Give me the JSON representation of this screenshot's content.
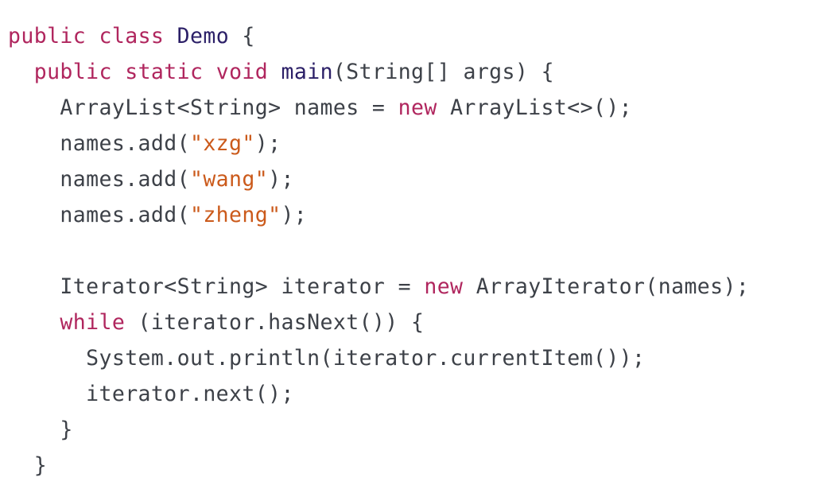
{
  "colors": {
    "default": "#3d4148",
    "keyword": "#b0265e",
    "class_name": "#2b1f67",
    "method_name": "#2b1f67",
    "string": "#cb5a1b"
  },
  "code": {
    "lines": [
      {
        "indent": 0,
        "tokens": [
          {
            "text": "public",
            "kind": "keyword"
          },
          {
            "text": " ",
            "kind": "default"
          },
          {
            "text": "class",
            "kind": "keyword"
          },
          {
            "text": " ",
            "kind": "default"
          },
          {
            "text": "Demo",
            "kind": "class_name"
          },
          {
            "text": " {",
            "kind": "default"
          }
        ]
      },
      {
        "indent": 1,
        "tokens": [
          {
            "text": "public",
            "kind": "keyword"
          },
          {
            "text": " ",
            "kind": "default"
          },
          {
            "text": "static",
            "kind": "keyword"
          },
          {
            "text": " ",
            "kind": "default"
          },
          {
            "text": "void",
            "kind": "keyword"
          },
          {
            "text": " ",
            "kind": "default"
          },
          {
            "text": "main",
            "kind": "method_name"
          },
          {
            "text": "(String[] args) {",
            "kind": "default"
          }
        ]
      },
      {
        "indent": 2,
        "tokens": [
          {
            "text": "ArrayList<String> names = ",
            "kind": "default"
          },
          {
            "text": "new",
            "kind": "keyword"
          },
          {
            "text": " ArrayList<>();",
            "kind": "default"
          }
        ]
      },
      {
        "indent": 2,
        "tokens": [
          {
            "text": "names.add(",
            "kind": "default"
          },
          {
            "text": "\"xzg\"",
            "kind": "string"
          },
          {
            "text": ");",
            "kind": "default"
          }
        ]
      },
      {
        "indent": 2,
        "tokens": [
          {
            "text": "names.add(",
            "kind": "default"
          },
          {
            "text": "\"wang\"",
            "kind": "string"
          },
          {
            "text": ");",
            "kind": "default"
          }
        ]
      },
      {
        "indent": 2,
        "tokens": [
          {
            "text": "names.add(",
            "kind": "default"
          },
          {
            "text": "\"zheng\"",
            "kind": "string"
          },
          {
            "text": ");",
            "kind": "default"
          }
        ]
      },
      {
        "indent": 0,
        "tokens": []
      },
      {
        "indent": 2,
        "tokens": [
          {
            "text": "Iterator<String> iterator = ",
            "kind": "default"
          },
          {
            "text": "new",
            "kind": "keyword"
          },
          {
            "text": " ArrayIterator(names);",
            "kind": "default"
          }
        ]
      },
      {
        "indent": 2,
        "tokens": [
          {
            "text": "while",
            "kind": "keyword"
          },
          {
            "text": " (iterator.hasNext()) {",
            "kind": "default"
          }
        ]
      },
      {
        "indent": 3,
        "tokens": [
          {
            "text": "System.out.println(iterator.currentItem());",
            "kind": "default"
          }
        ]
      },
      {
        "indent": 3,
        "tokens": [
          {
            "text": "iterator.next();",
            "kind": "default"
          }
        ]
      },
      {
        "indent": 2,
        "tokens": [
          {
            "text": "}",
            "kind": "default"
          }
        ]
      },
      {
        "indent": 1,
        "tokens": [
          {
            "text": "}",
            "kind": "default"
          }
        ]
      }
    ]
  }
}
